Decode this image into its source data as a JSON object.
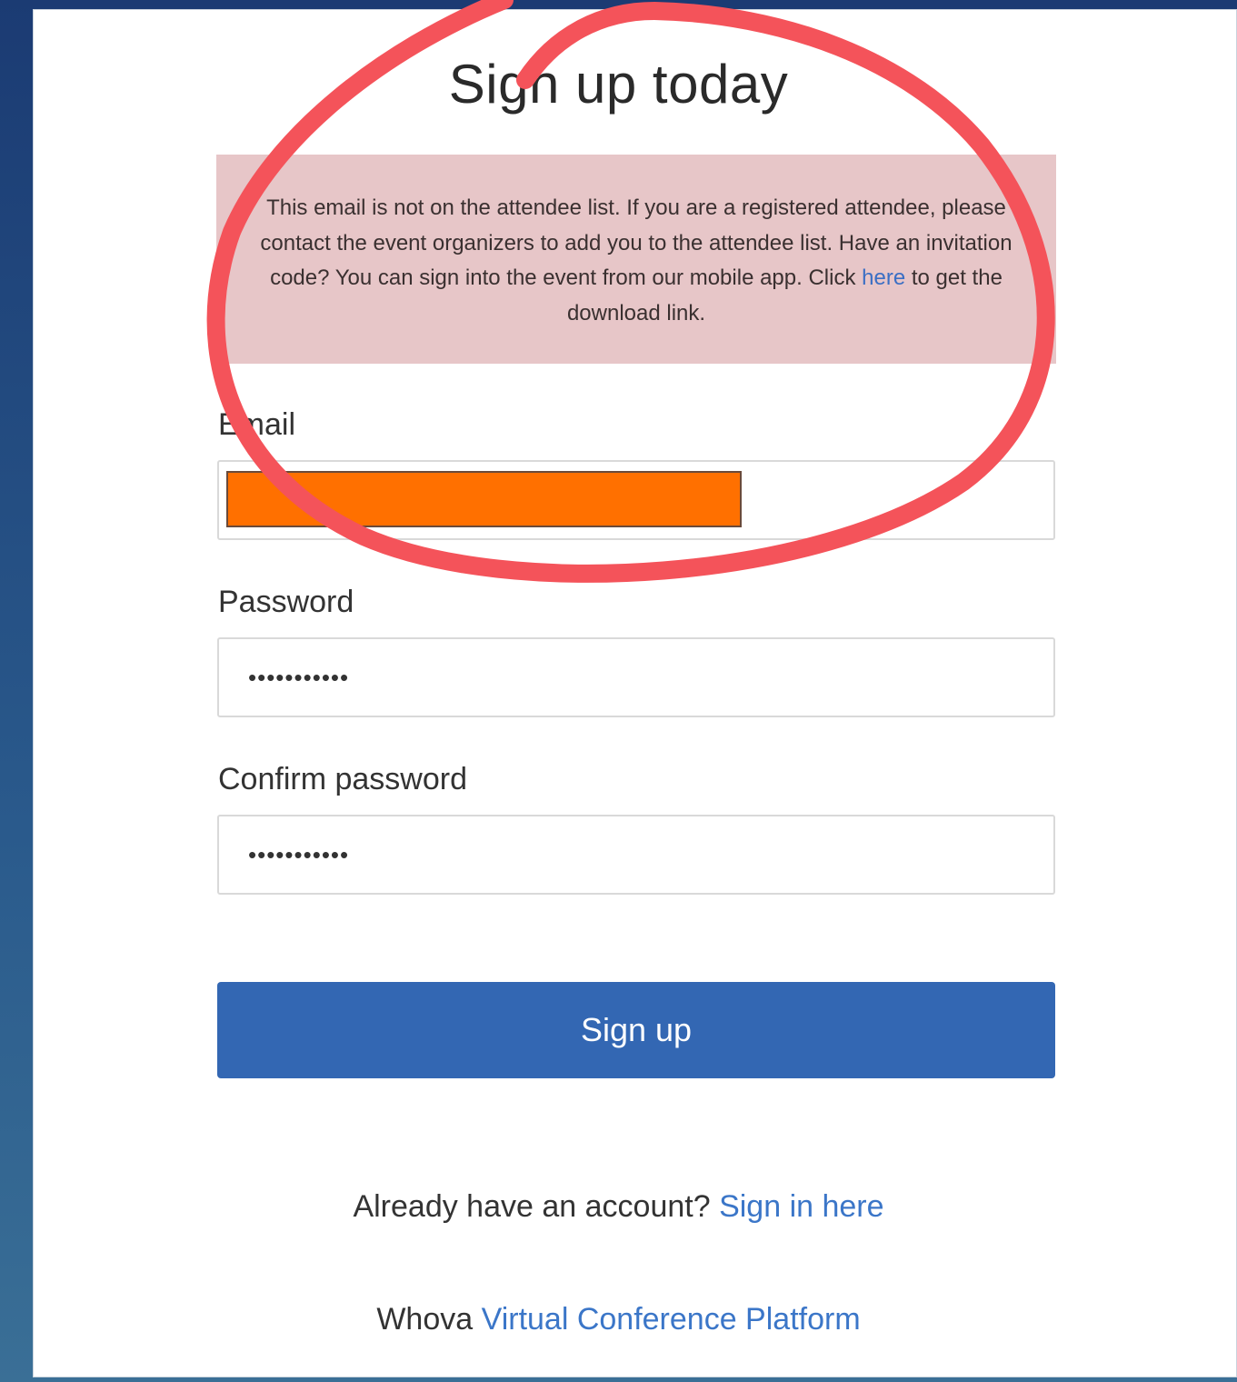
{
  "page": {
    "title": "Sign up today"
  },
  "alert": {
    "text_before": "This email is not on the attendee list. If you are a registered attendee, please contact the event organizers to add you to the attendee list. Have an invitation code? You can sign into the event from our mobile app. Click ",
    "link_label": "here",
    "text_after": " to get the download link."
  },
  "form": {
    "email_label": "Email",
    "password_label": "Password",
    "password_value": "•••••••••••",
    "confirm_label": "Confirm password",
    "confirm_value": "•••••••••••",
    "submit_label": "Sign up"
  },
  "footer": {
    "account_prompt": "Already have an account?",
    "signin_link": "Sign in here",
    "brand": "Whova",
    "platform_link": "Virtual Conference Platform"
  },
  "colors": {
    "alert_background": "#e7c6c8",
    "button_primary": "#3367b3",
    "link": "#3b76c8",
    "redaction": "#ff7000",
    "annotation_circle": "#f4535a"
  }
}
